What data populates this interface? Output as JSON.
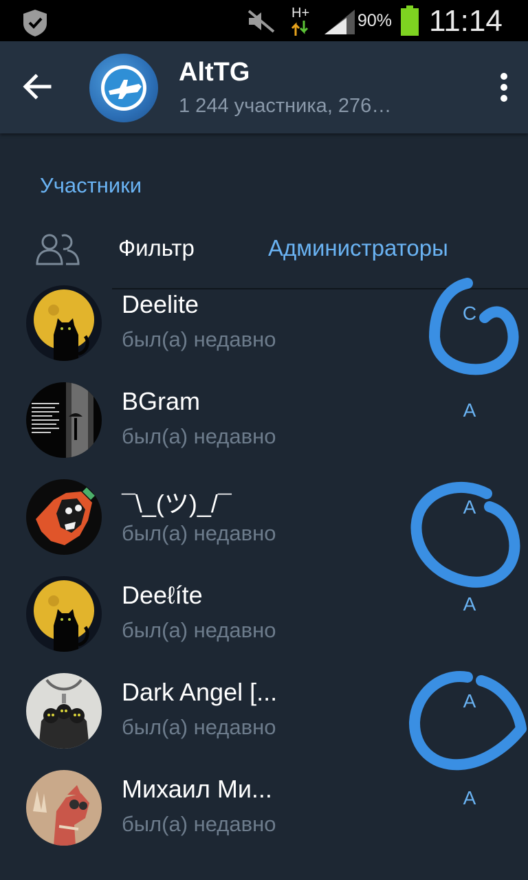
{
  "status_bar": {
    "battery": "90%",
    "time": "11:14",
    "network": "H+"
  },
  "app_bar": {
    "title": "AltTG",
    "subtitle": "1 244 участника, 276…"
  },
  "section_title": "Участники",
  "filter": {
    "label": "Фильтр",
    "value": "Администраторы"
  },
  "members": [
    {
      "name": "Deelite",
      "status": "был(а) недавно",
      "role": "C"
    },
    {
      "name": "BGram",
      "status": "был(а) недавно",
      "role": "A"
    },
    {
      "name": "¯\\_(ツ)_/¯",
      "status": "был(а) недавно",
      "role": "A"
    },
    {
      "name": "Deeℓíte",
      "status": "был(а) недавно",
      "role": "A"
    },
    {
      "name": "Dark Angel [...",
      "status": "был(а) недавно",
      "role": "A"
    },
    {
      "name": "Михаил Ми...",
      "status": "был(а) недавно",
      "role": "A"
    }
  ],
  "colors": {
    "background": "#1d2733",
    "app_bar": "#243140",
    "accent": "#6ab3f3",
    "secondary_text": "#6d7c8c",
    "annotation": "#3a8fe3"
  }
}
